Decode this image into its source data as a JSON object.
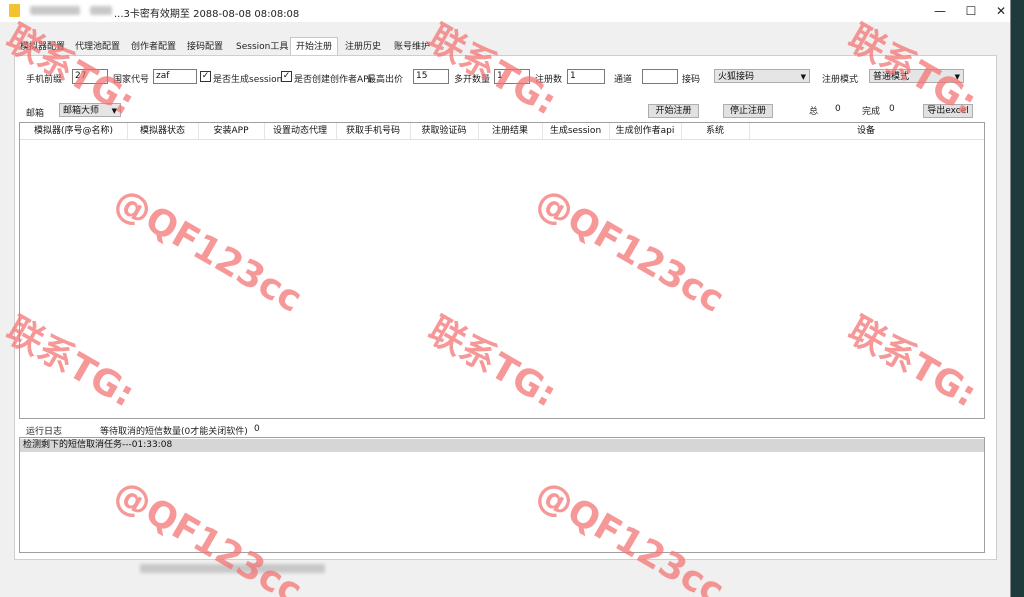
{
  "titlebar": {
    "title_suffix": "...3卡密有效期至 2088-08-08 08:08:08",
    "min_glyph": "—",
    "max_glyph": "☐",
    "close_glyph": "✕"
  },
  "tabs": [
    "模拟器配置",
    "代理池配置",
    "创作者配置",
    "接码配置",
    "Session工具",
    "开始注册",
    "注册历史",
    "账号维护"
  ],
  "form": {
    "phone_prefix_label": "手机前缀",
    "phone_prefix_value": "27",
    "country_code_label": "国家代号",
    "country_code_value": "zaf",
    "gen_session_label": "是否生成session",
    "gen_session_checked": "✓",
    "create_api_label": "是否创建创作者API",
    "create_api_checked": "✓",
    "max_price_label": "最高出价",
    "max_price_value": "15",
    "multi_count_label": "多开数量",
    "multi_count_value": "1",
    "reg_count_label": "注册数",
    "reg_count_value": "1",
    "channel_label": "通道",
    "channel_value": "",
    "sms_label": "接码",
    "sms_value": "火狐接码",
    "mode_label": "注册模式",
    "mode_value": "普通模式",
    "email_label": "邮箱",
    "email_value": "邮箱大师",
    "start_button": "开始注册",
    "stop_button": "停止注册",
    "total_label": "总",
    "total_value": "0",
    "done_label": "完成",
    "done_value": "0",
    "export_button": "导出excel"
  },
  "grid_columns": [
    "模拟器(序号@名称)",
    "模拟器状态",
    "安装APP",
    "设置动态代理",
    "获取手机号码",
    "获取验证码",
    "注册结果",
    "生成session",
    "生成创作者api",
    "系统",
    "设备"
  ],
  "log": {
    "label": "运行日志",
    "pending_label": "等待取消的短信数量(0才能关闭软件)",
    "pending_value": "0",
    "lines": [
      "检测剩下的短信取消任务---01:33:08"
    ]
  },
  "watermark": {
    "line1": "联系TG:",
    "line2": "@QF123cc"
  },
  "colors": {
    "watermark": "#f47070",
    "panel_bg": "#ffffff",
    "window_bg": "#f0f0f0",
    "log_highlight": "#d6d6d6"
  },
  "icons": {
    "app_icon": "folder-icon"
  }
}
